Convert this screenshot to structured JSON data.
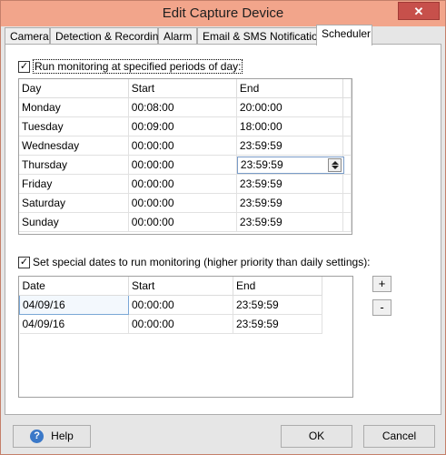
{
  "window": {
    "title": "Edit Capture Device",
    "close_glyph": "✕"
  },
  "tabs": [
    {
      "label": "Camera"
    },
    {
      "label": "Detection & Recording"
    },
    {
      "label": "Alarm"
    },
    {
      "label": "Email & SMS Notifications"
    },
    {
      "label": "Scheduler",
      "active": true
    }
  ],
  "daily": {
    "checked": true,
    "checkbox_label": "Run monitoring at specified periods of day:",
    "columns": [
      "Day",
      "Start",
      "End"
    ],
    "rows": [
      {
        "day": "Monday",
        "start": "00:08:00",
        "end": "20:00:00"
      },
      {
        "day": "Tuesday",
        "start": "00:09:00",
        "end": "18:00:00"
      },
      {
        "day": "Wednesday",
        "start": "00:00:00",
        "end": "23:59:59"
      },
      {
        "day": "Thursday",
        "start": "00:00:00",
        "end": "23:59:59",
        "editing": true
      },
      {
        "day": "Friday",
        "start": "00:00:00",
        "end": "23:59:59"
      },
      {
        "day": "Saturday",
        "start": "00:00:00",
        "end": "23:59:59"
      },
      {
        "day": "Sunday",
        "start": "00:00:00",
        "end": "23:59:59"
      }
    ]
  },
  "special": {
    "checked": true,
    "checkbox_label": "Set special dates to run monitoring (higher priority than daily settings):",
    "columns": [
      "Date",
      "Start",
      "End"
    ],
    "rows": [
      {
        "date": "04/09/16",
        "start": "00:00:00",
        "end": "23:59:59",
        "selected": true
      },
      {
        "date": "04/09/16",
        "start": "00:00:00",
        "end": "23:59:59"
      }
    ],
    "add_label": "+",
    "remove_label": "-"
  },
  "footer": {
    "help_icon": "?",
    "help_label": "Help",
    "ok_label": "OK",
    "cancel_label": "Cancel"
  }
}
